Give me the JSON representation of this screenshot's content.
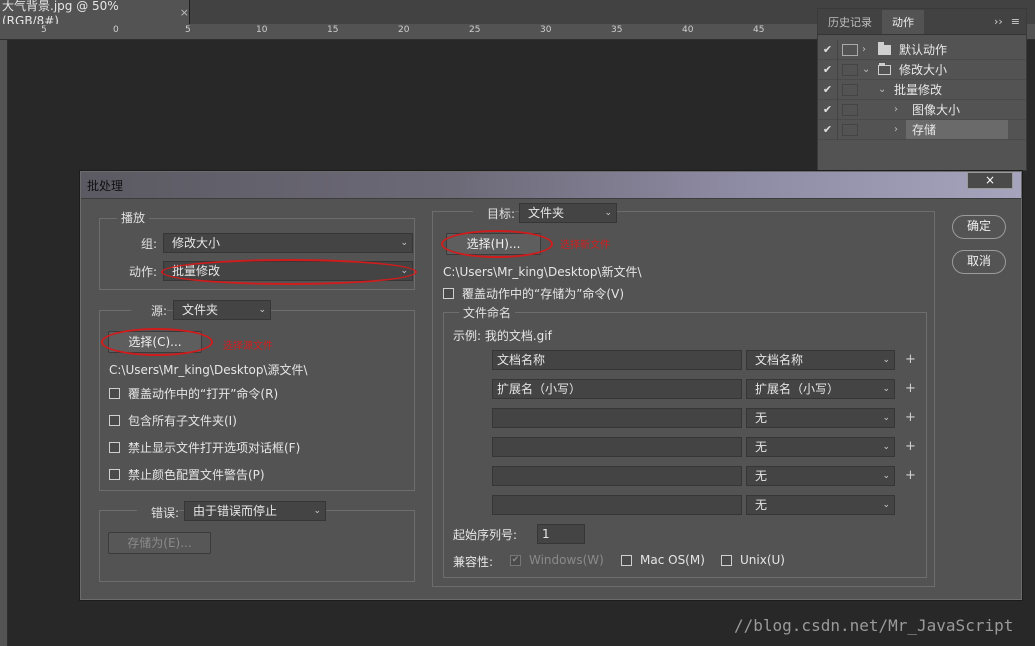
{
  "document": {
    "tab_title": "大气背景.jpg @ 50%(RGB/8#)",
    "close_glyph": "×"
  },
  "ruler": {
    "labels": [
      "5",
      "0",
      "5",
      "10",
      "15",
      "20",
      "25",
      "30",
      "35",
      "40",
      "45"
    ]
  },
  "actions_panel": {
    "tabs": [
      "历史记录",
      "动作"
    ],
    "icons": [
      "››",
      "≡"
    ],
    "rows": [
      {
        "check": "✔",
        "label": "默认动作"
      },
      {
        "check": "✔",
        "label": "修改大小"
      },
      {
        "check": "✔",
        "label": "批量修改"
      },
      {
        "check": "✔",
        "label": "图像大小"
      },
      {
        "check": "✔",
        "label": "存储"
      }
    ]
  },
  "dialog": {
    "title": "批处理",
    "close": "×",
    "play": {
      "legend": "播放",
      "group_label": "组:",
      "group_value": "修改大小",
      "action_label": "动作:",
      "action_value": "批量修改"
    },
    "source": {
      "label": "源:",
      "value": "文件夹",
      "choose_button": "选择(C)...",
      "annotation": "选择源文件",
      "path": "C:\\Users\\Mr_king\\Desktop\\源文件\\",
      "options": [
        "覆盖动作中的“打开”命令(R)",
        "包含所有子文件夹(I)",
        "禁止显示文件打开选项对话框(F)",
        "禁止颜色配置文件警告(P)"
      ]
    },
    "errors": {
      "label": "错误:",
      "value": "由于错误而停止",
      "save_as_button": "存储为(E)..."
    },
    "target": {
      "label": "目标:",
      "value": "文件夹",
      "choose_button": "选择(H)...",
      "annotation": "选择新文件",
      "path": "C:\\Users\\Mr_king\\Desktop\\新文件\\",
      "override_save": "覆盖动作中的“存储为”命令(V)"
    },
    "file_naming": {
      "legend": "文件命名",
      "example": "示例: 我的文档.gif",
      "rows": [
        {
          "text": "文档名称",
          "select": "文档名称",
          "plus": "+"
        },
        {
          "text": "扩展名（小写）",
          "select": "扩展名（小写）",
          "plus": "+"
        },
        {
          "text": "",
          "select": "无",
          "plus": "+"
        },
        {
          "text": "",
          "select": "无",
          "plus": "+"
        },
        {
          "text": "",
          "select": "无",
          "plus": "+"
        },
        {
          "text": "",
          "select": "无",
          "plus": ""
        }
      ],
      "start_serial_label": "起始序列号:",
      "start_serial_value": "1",
      "compat_label": "兼容性:",
      "compat": [
        "Windows(W)",
        "Mac OS(M)",
        "Unix(U)"
      ]
    },
    "ok_button": "确定",
    "cancel_button": "取消"
  },
  "watermark": "//blog.csdn.net/Mr_JavaScript"
}
